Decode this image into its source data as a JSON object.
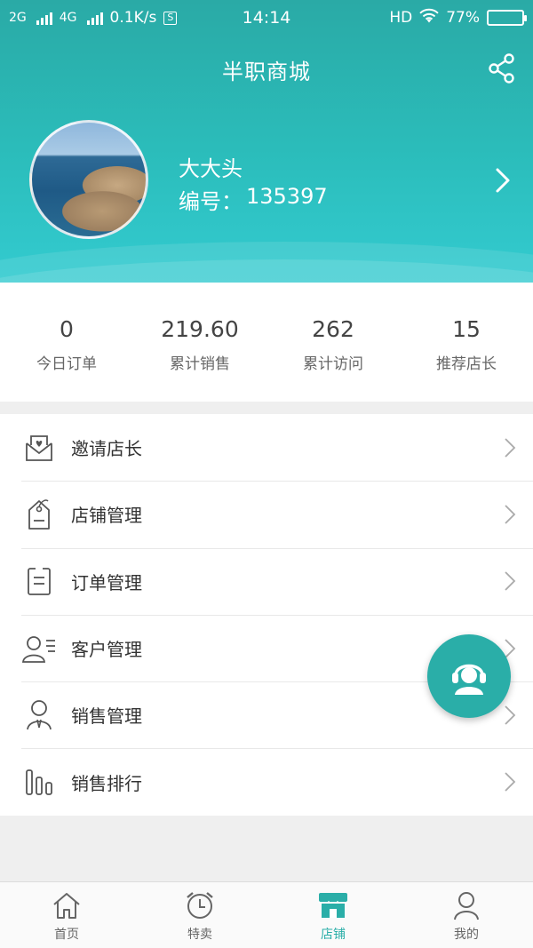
{
  "status_bar": {
    "net1": "2G",
    "net2": "4G",
    "speed": "0.1K/s",
    "s_badge": "S",
    "time": "14:14",
    "hd": "HD",
    "battery": "77%",
    "battery_level": 0.77
  },
  "header": {
    "title": "半职商城",
    "share_icon": "share-icon"
  },
  "profile": {
    "name": "大大头",
    "id_label": "编号：",
    "id_value": "135397"
  },
  "stats": [
    {
      "value": "0",
      "label": "今日订单"
    },
    {
      "value": "219.60",
      "label": "累计销售"
    },
    {
      "value": "262",
      "label": "累计访问"
    },
    {
      "value": "15",
      "label": "推荐店长"
    }
  ],
  "menu": [
    {
      "label": "邀请店长",
      "icon": "invite-envelope-icon"
    },
    {
      "label": "店铺管理",
      "icon": "store-tag-icon"
    },
    {
      "label": "订单管理",
      "icon": "order-list-icon"
    },
    {
      "label": "客户管理",
      "icon": "customers-icon"
    },
    {
      "label": "销售管理",
      "icon": "sales-person-icon"
    },
    {
      "label": "销售排行",
      "icon": "ranking-bars-icon"
    }
  ],
  "tabs": [
    {
      "label": "首页",
      "icon": "home-icon",
      "active": false
    },
    {
      "label": "特卖",
      "icon": "alarm-clock-icon",
      "active": false
    },
    {
      "label": "店铺",
      "icon": "store-icon",
      "active": true
    },
    {
      "label": "我的",
      "icon": "person-icon",
      "active": false
    }
  ],
  "colors": {
    "accent": "#2aaea8",
    "header_top": "#2aaaa6",
    "header_bottom": "#33cbd0"
  }
}
